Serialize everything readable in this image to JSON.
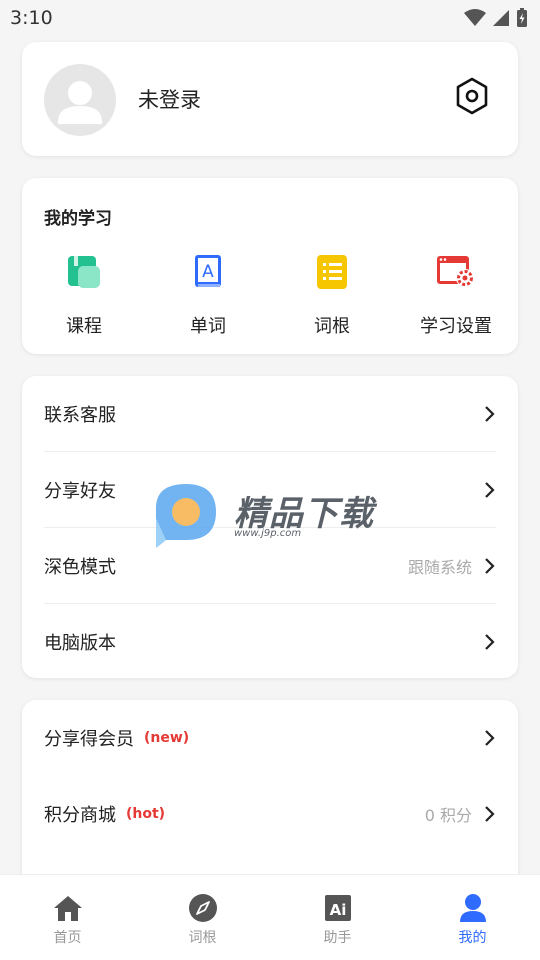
{
  "status_bar": {
    "time": "3:10"
  },
  "profile": {
    "name": "未登录"
  },
  "study": {
    "title": "我的学习",
    "items": [
      {
        "label": "课程",
        "icon": "course-book-icon",
        "color": "#2ec79a"
      },
      {
        "label": "单词",
        "icon": "word-book-icon",
        "color": "#2f6bff"
      },
      {
        "label": "词根",
        "icon": "list-note-icon",
        "color": "#f6c700"
      },
      {
        "label": "学习设置",
        "icon": "window-gear-icon",
        "color": "#e53935"
      }
    ]
  },
  "menu": {
    "contact": "联系客服",
    "share": "分享好友",
    "dark_mode": "深色模式",
    "dark_mode_value": "跟随系统",
    "desktop": "电脑版本"
  },
  "vip": {
    "share_vip": "分享得会员",
    "share_vip_tag": "(new)",
    "points_mall": "积分商城",
    "points_mall_tag": "(hot)",
    "points_value": "0 积分"
  },
  "watermark": {
    "text": "精品下载",
    "url": "www.j9p.com"
  },
  "bottom_nav": {
    "items": [
      {
        "label": "首页",
        "icon": "home-icon"
      },
      {
        "label": "词根",
        "icon": "compass-icon"
      },
      {
        "label": "助手",
        "icon": "ai-icon"
      },
      {
        "label": "我的",
        "icon": "user-icon",
        "active": true
      }
    ]
  },
  "colors": {
    "accent": "#2f6bff",
    "tag": "#e53935"
  }
}
